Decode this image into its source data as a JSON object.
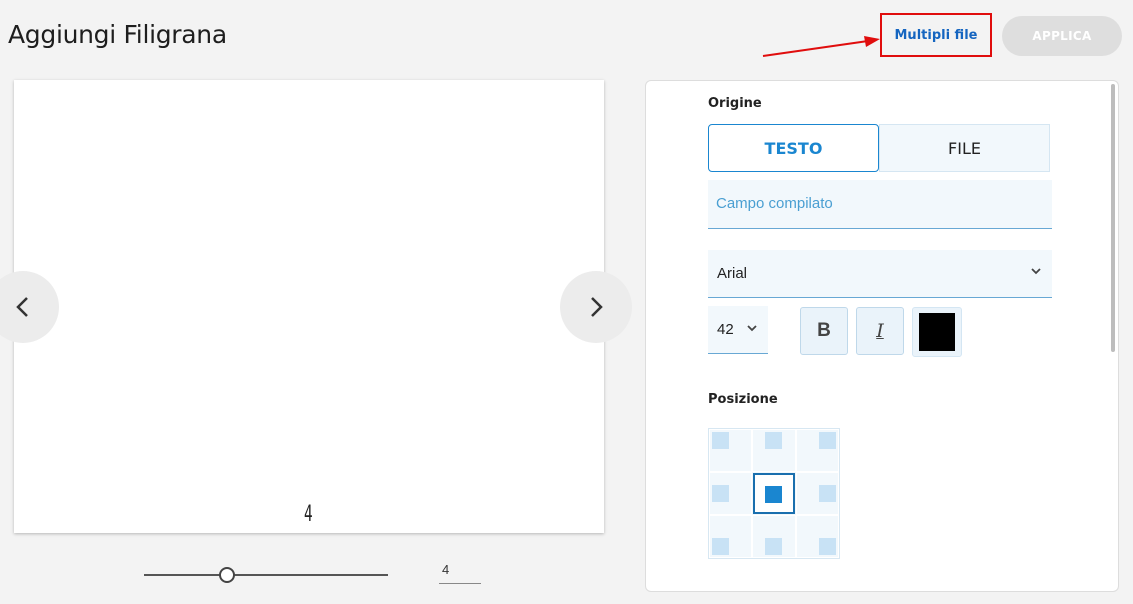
{
  "header": {
    "title": "Aggiungi Filigrana",
    "multi_file_label": "Multipli file",
    "apply_label": "APPLICA"
  },
  "preview": {
    "page_number_shown": "4",
    "page_input_value": "4",
    "slider_position_fraction": 0.33
  },
  "panel": {
    "origin_label": "Origine",
    "tabs": [
      {
        "label": "TESTO",
        "active": true
      },
      {
        "label": "FILE",
        "active": false
      }
    ],
    "text_field_value": "Campo compilato",
    "font_value": "Arial",
    "size_value": "42",
    "bold_label": "B",
    "italic_label": "I",
    "color_value": "#000000",
    "position_label": "Posizione",
    "position_selected": "center"
  },
  "colors": {
    "accent": "#1a86d0",
    "annotation": "#e00d0d"
  }
}
